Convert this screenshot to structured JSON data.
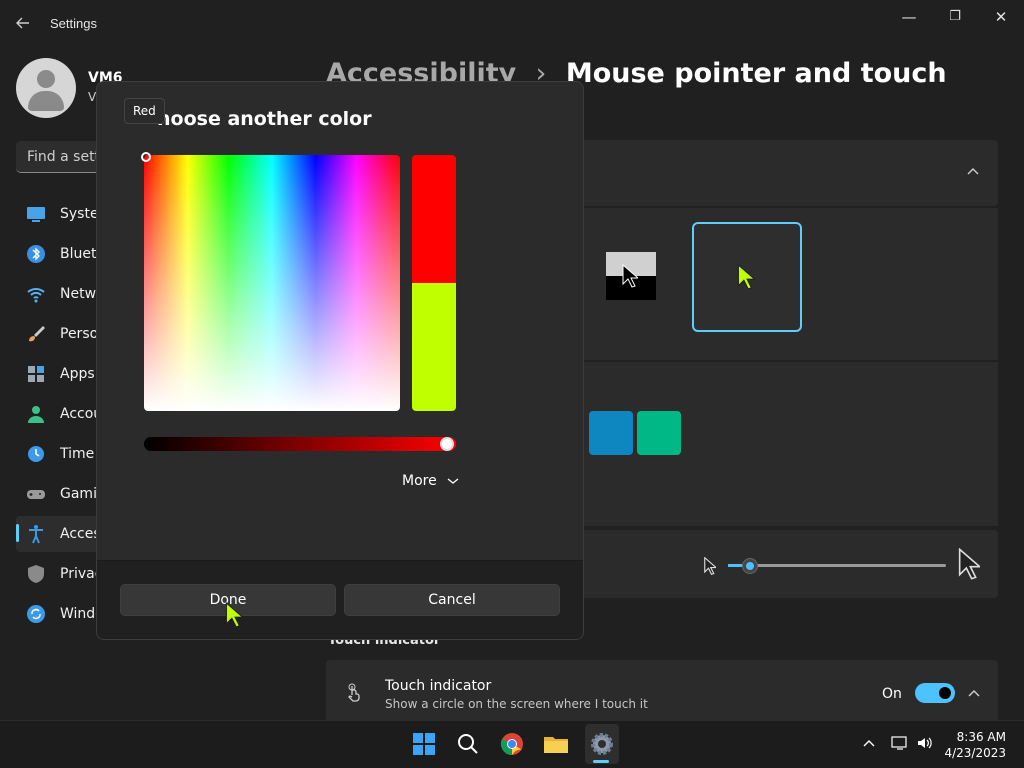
{
  "window": {
    "title": "Settings",
    "back_icon": "arrow-left-icon",
    "minimize": "—",
    "maximize": "❐",
    "close": "✕"
  },
  "user": {
    "name": "VM6",
    "sub": "V"
  },
  "search": {
    "placeholder": "Find a setti"
  },
  "sidebar": {
    "items": [
      {
        "label": "Syster",
        "icon": "system-icon",
        "color": "#4aa3e8"
      },
      {
        "label": "Blueto",
        "icon": "bluetooth-icon",
        "color": "#3b8ee0"
      },
      {
        "label": "Netwo",
        "icon": "network-icon",
        "color": "#5ab0f0"
      },
      {
        "label": "Perso",
        "icon": "brush-icon",
        "color": "#e8a060"
      },
      {
        "label": "Apps",
        "icon": "apps-icon",
        "color": "#9aa8b8"
      },
      {
        "label": "Accou",
        "icon": "account-icon",
        "color": "#3dbf8a"
      },
      {
        "label": "Time",
        "icon": "clock-icon",
        "color": "#3d9ae8"
      },
      {
        "label": "Gamin",
        "icon": "gamepad-icon",
        "color": "#9a9a9a"
      },
      {
        "label": "Acces",
        "icon": "accessibility-icon",
        "color": "#3d9ae8"
      },
      {
        "label": "Privac",
        "icon": "shield-icon",
        "color": "#8a8a8a"
      },
      {
        "label": "Windo",
        "icon": "update-icon",
        "color": "#3d9ae8"
      }
    ],
    "active_index": 8
  },
  "breadcrumb": {
    "parent": "Accessibility",
    "separator": "›",
    "current": "Mouse pointer and touch"
  },
  "touch": {
    "section_label": "Touch indicator",
    "title": "Touch indicator",
    "desc": "Show a circle on the screen where I touch it",
    "state": "On"
  },
  "swatches": [
    "#0e87c0",
    "#00b886"
  ],
  "dialog": {
    "title": "hoose another color",
    "tooltip": "Red",
    "more_label": "More",
    "done_label": "Done",
    "cancel_label": "Cancel",
    "old_color": "#ff0000",
    "new_color": "#c0ff00",
    "slider_value": 1.0
  },
  "taskbar": {
    "time": "8:36 AM",
    "date": "4/23/2023"
  }
}
